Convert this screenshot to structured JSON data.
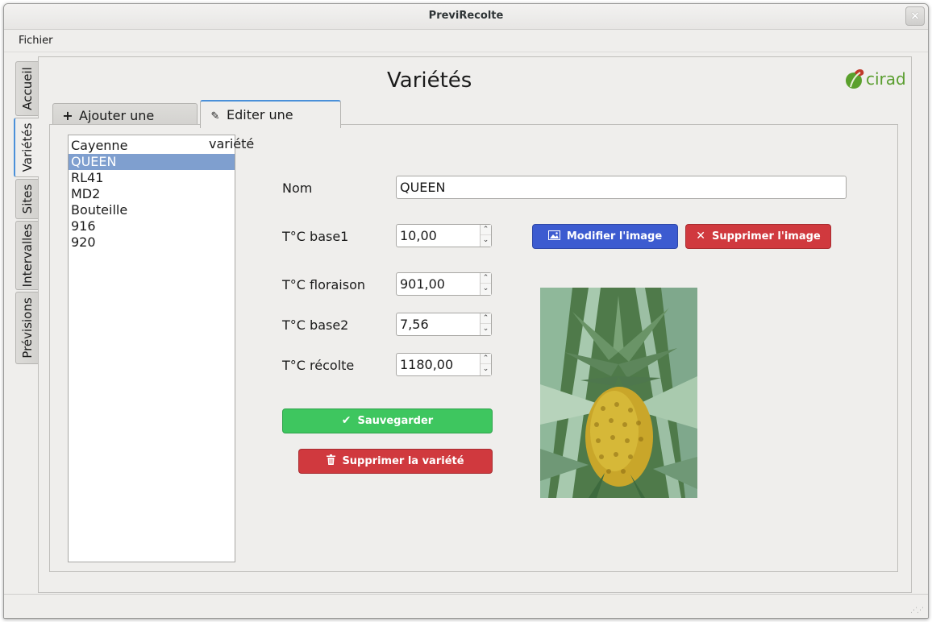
{
  "window": {
    "title": "PreviRecolte",
    "close_glyph": "×"
  },
  "menubar": {
    "items": [
      "Fichier"
    ]
  },
  "side_tabs": [
    "Accueil",
    "Variétés",
    "Sites",
    "Intervalles",
    "Prévisions"
  ],
  "page": {
    "title": "Variétés",
    "logo_text": "cirad"
  },
  "tabs": [
    {
      "label": "Ajouter une variété",
      "icon": "plus-icon",
      "glyph": "+"
    },
    {
      "label": "Editer une variété",
      "icon": "pencil-icon",
      "glyph": "✎"
    }
  ],
  "varieties": [
    "Cayenne",
    "QUEEN",
    "RL41",
    "MD2",
    "Bouteille",
    "916",
    "920"
  ],
  "selected_variety": "QUEEN",
  "form": {
    "nom_label": "Nom",
    "nom_value": "QUEEN",
    "base1_label": "T°C base1",
    "base1_value": "10,00",
    "floraison_label": "T°C floraison",
    "floraison_value": "901,00",
    "base2_label": "T°C base2",
    "base2_value": "7,56",
    "recolte_label": "T°C récolte",
    "recolte_value": "1180,00"
  },
  "buttons": {
    "modify_image": "Modifier l'image",
    "delete_image": "Supprimer l'image",
    "save": "Sauvegarder",
    "delete_variety": "Supprimer la variété"
  },
  "colors": {
    "blue_button": "#3c5bd0",
    "red_button": "#d0393e",
    "green_button": "#3ec65f",
    "selection": "#7f9fcf",
    "logo_green": "#5a9e2f"
  }
}
